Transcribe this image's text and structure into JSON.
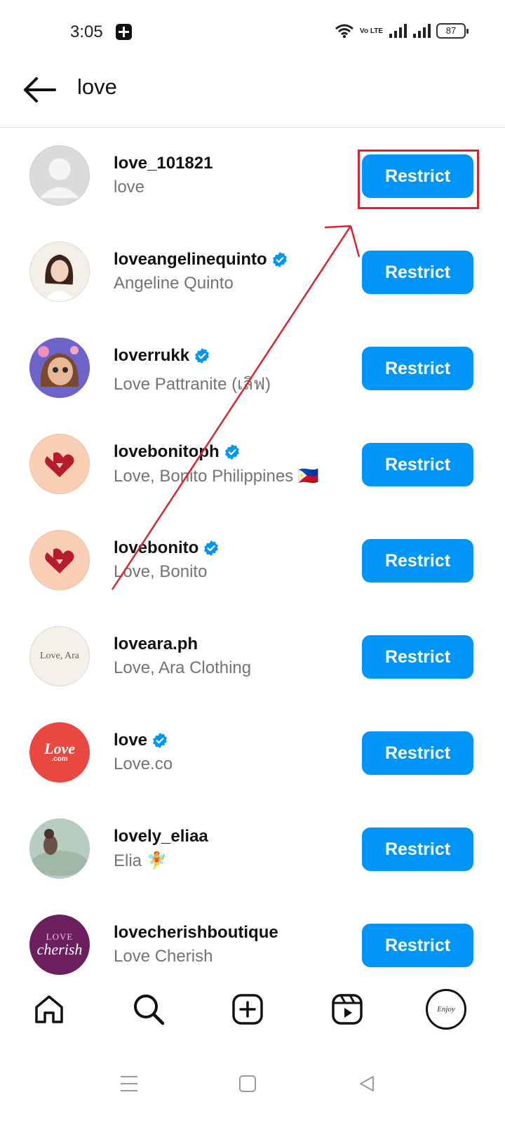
{
  "status_bar": {
    "time": "3:05",
    "battery": "87",
    "network_label": "Vo LTE"
  },
  "header": {
    "search_query": "love"
  },
  "results": [
    {
      "username": "love_101821",
      "full_name": "love",
      "verified": false,
      "button": "Restrict",
      "avatar": "default-avatar"
    },
    {
      "username": "loveangelinequinto",
      "full_name": "Angeline Quinto",
      "verified": true,
      "button": "Restrict",
      "avatar": "photo-woman"
    },
    {
      "username": "loverrukk",
      "full_name": "Love Pattranite (เลิฟ)",
      "verified": true,
      "button": "Restrict",
      "avatar": "cartoon-girl"
    },
    {
      "username": "lovebonitoph",
      "full_name": "Love, Bonito Philippines 🇵🇭",
      "verified": true,
      "button": "Restrict",
      "avatar": "bonito-logo"
    },
    {
      "username": "lovebonito",
      "full_name": "Love, Bonito",
      "verified": true,
      "button": "Restrict",
      "avatar": "bonito-logo"
    },
    {
      "username": "loveara.ph",
      "full_name": "Love, Ara Clothing",
      "verified": false,
      "button": "Restrict",
      "avatar": "love-ara-logo",
      "avatar_text": "Love, Ara"
    },
    {
      "username": "love",
      "full_name": "Love.co",
      "verified": true,
      "button": "Restrict",
      "avatar": "love-com-logo",
      "avatar_text": "Love",
      "avatar_subtext": ".com"
    },
    {
      "username": "lovely_eliaa",
      "full_name": "Elia 🧚",
      "verified": false,
      "button": "Restrict",
      "avatar": "photo-sea"
    },
    {
      "username": "lovecherishboutique",
      "full_name": "Love Cherish",
      "verified": false,
      "button": "Restrict",
      "avatar": "love-cherish-logo",
      "avatar_text": "LOVE",
      "avatar_subtext": "cherish"
    }
  ],
  "colors": {
    "button_blue": "#0095f6",
    "verified_blue": "#0095f6",
    "annotation_red": "#d8242f",
    "secondary_text": "#737373"
  },
  "bottom_nav": {
    "items": [
      "home-icon",
      "search-icon",
      "create-icon",
      "reels-icon",
      "profile-avatar"
    ],
    "profile_avatar_text": "Enjoy"
  },
  "system_nav": {
    "items": [
      "menu-icon",
      "home-square-icon",
      "back-triangle-icon"
    ]
  }
}
